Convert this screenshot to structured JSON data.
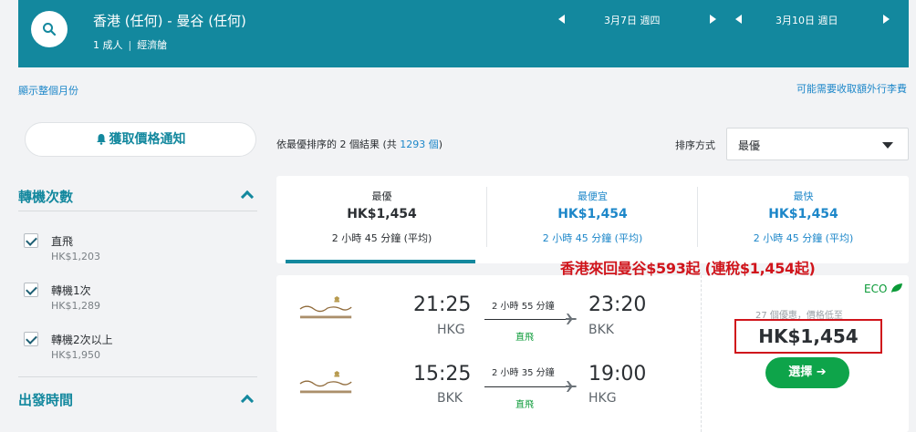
{
  "header": {
    "route": "香港 (任何) - 曼谷 (任何)",
    "passengers": "1 成人",
    "cabin": "經濟艙",
    "depart_date": "3月7日 週四",
    "return_date": "3月10日 週日"
  },
  "links": {
    "show_month": "顯示整個月份",
    "baggage_fee": "可能需要收取額外行李費"
  },
  "sidebar": {
    "alert_button": "獲取價格通知",
    "stops_title": "轉機次數",
    "stops": [
      {
        "label": "直飛",
        "price": "HK$1,203"
      },
      {
        "label": "轉機1次",
        "price": "HK$1,289"
      },
      {
        "label": "轉機2次以上",
        "price": "HK$1,950"
      }
    ],
    "depart_time_title": "出發時間"
  },
  "results": {
    "count_prefix": "依最優排序的 2 個結果 (共 ",
    "count_total": "1293 個",
    "count_suffix": ")",
    "sort_label": "排序方式",
    "sort_value": "最優"
  },
  "tabs": [
    {
      "name": "最優",
      "price": "HK$1,454",
      "duration": "2 小時 45 分鐘 (平均)"
    },
    {
      "name": "最便宜",
      "price": "HK$1,454",
      "duration": "2 小時 45 分鐘 (平均)"
    },
    {
      "name": "最快",
      "price": "HK$1,454",
      "duration": "2 小時 45 分鐘 (平均)"
    }
  ],
  "promo": "香港來回曼谷$593起 (連稅$1,454起)",
  "card": {
    "outbound": {
      "dep_time": "21:25",
      "dep_code": "HKG",
      "duration": "2 小時 55 分鐘",
      "stops": "直飛",
      "arr_time": "23:20",
      "arr_code": "BKK"
    },
    "inbound": {
      "dep_time": "15:25",
      "dep_code": "BKK",
      "duration": "2 小時 35 分鐘",
      "stops": "直飛",
      "arr_time": "19:00",
      "arr_code": "HKG"
    },
    "eco": "ECO",
    "deals": "27 個優惠，價格低至",
    "price": "HK$1,454",
    "select": "選擇 ➔"
  },
  "colors": {
    "header_bg": "#13889e",
    "link": "#1d87c9",
    "green": "#0ea44a",
    "promo_red": "#d0141b"
  }
}
